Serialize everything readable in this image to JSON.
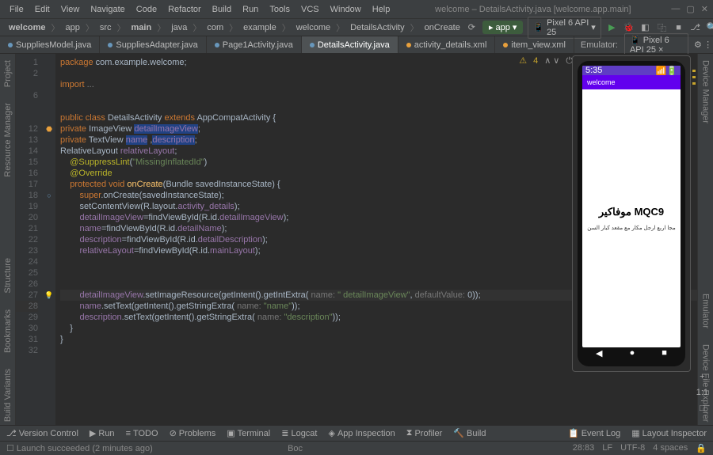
{
  "titlebar": {
    "menus": [
      "File",
      "Edit",
      "View",
      "Navigate",
      "Code",
      "Refactor",
      "Build",
      "Run",
      "Tools",
      "VCS",
      "Window",
      "Help"
    ],
    "title": "welcome – DetailsActivity.java [welcome.app.main]"
  },
  "breadcrumbs": [
    "welcome",
    "app",
    "src",
    "main",
    "java",
    "com",
    "example",
    "welcome",
    "DetailsActivity",
    "onCreate"
  ],
  "runconfig": {
    "label": "app",
    "device": "Pixel 6 API 25"
  },
  "tabs": [
    {
      "label": "SuppliesModel.java"
    },
    {
      "label": "SuppliesAdapter.java"
    },
    {
      "label": "Page1Activity.java"
    },
    {
      "label": "DetailsActivity.java",
      "active": true
    },
    {
      "label": "activity_details.xml"
    },
    {
      "label": "item_view.xml"
    }
  ],
  "emulator": {
    "label": "Emulator:",
    "device": "Pixel 6 API 25"
  },
  "leftrail": [
    "Project",
    "Resource Manager"
  ],
  "leftrail2": [
    "Bookmarks",
    "Structure"
  ],
  "leftrail3": [
    "Build Variants"
  ],
  "rightrail": [
    "Device Manager"
  ],
  "rightrail2": [
    "Emulator",
    "Device File Explorer"
  ],
  "warn": {
    "count": "4"
  },
  "lines": {
    "1": "1",
    "2": "2",
    "6": "6",
    "10": " ",
    "11": " ",
    "12": "12",
    "13": "13",
    "14": "14",
    "15": "15",
    "16": "16",
    "17": "17",
    "18": "18",
    "19": "19",
    "20": "20",
    "21": "21",
    "22": "22",
    "23": "23",
    "24": "24",
    "25": "25",
    "26": "26",
    "27": "27",
    "28": "28",
    "29": "29",
    "30": "30",
    "31": "31",
    "32": "32"
  },
  "code": {
    "l1_a": "package ",
    "l1_b": "com.example.welcome;",
    "l3_a": "import ",
    "l3_b": "...",
    "l5_a": "public class ",
    "l5_b": "DetailsActivity ",
    "l5_c": "extends ",
    "l5_d": "AppCompatActivity {",
    "l6_a": "private ",
    "l6_b": "ImageView ",
    "l6_c": "detailImageView",
    "l6_d": ";",
    "l7_a": "private ",
    "l7_b": "TextView ",
    "l7_c": "name",
    "l7_d": " ,",
    "l7_e": "description",
    "l7_f": ";",
    "l8_a": "RelativeLayout ",
    "l8_b": "relativeLayout",
    "l8_c": ";",
    "l9_a": "    @SuppressLint",
    "l9_b": "(",
    "l9_c": "\"MissingInflatedId\"",
    "l9_d": ")",
    "l10": "    @Override",
    "l11_a": "    protected void ",
    "l11_b": "onCreate",
    "l11_c": "(Bundle savedInstanceState) {",
    "l12_a": "        super",
    "l12_b": ".onCreate(savedInstanceState);",
    "l13_a": "        setContentView(R.layout.",
    "l13_b": "activity_details",
    "l13_c": ");",
    "l14_a": "        detailImageView",
    "l14_b": "=findViewById(R.id.",
    "l14_c": "detailImageView",
    "l14_d": ");",
    "l15_a": "        name",
    "l15_b": "=findViewById(R.id.",
    "l15_c": "detailName",
    "l15_d": ");",
    "l16_a": "        description",
    "l16_b": "=findViewById(R.id.",
    "l16_c": "detailDescription",
    "l16_d": ");",
    "l17_a": "        relativeLayout",
    "l17_b": "=findViewById(R.id.",
    "l17_c": "mainLayout",
    "l17_d": ");",
    "l21_a": "        detailImageView",
    "l21_b": ".setImageResource(getIntent().getIntExtra(",
    "l21_n": " name: ",
    "l21_c": "\" detailImageView\"",
    "l21_d": ", ",
    "l21_dv": "defaultValue: ",
    "l21_e": "0",
    "l21_f": "));",
    "l22_a": "        name",
    "l22_b": ".setText(getIntent().getStringExtra(",
    "l22_n": " name: ",
    "l22_c": "\"name\"",
    "l22_d": "));",
    "l23_a": "        description",
    "l23_b": ".setText(getIntent().getStringExtra(",
    "l23_n": " name: ",
    "l23_c": "\"description\"",
    "l23_d": "));",
    "l24": "    }",
    "l25": "}"
  },
  "phone": {
    "time": "5:35",
    "wifi": "▲",
    "appname": "welcome",
    "title": "موفاكير MQC9",
    "desc": "مجا اربع ارجل مكار مع مقعد كبار السن"
  },
  "bottombar": {
    "items": [
      "Version Control",
      "Run",
      "TODO",
      "Problems",
      "Terminal",
      "Logcat",
      "App Inspection",
      "Profiler",
      "Build"
    ],
    "right": [
      "Event Log",
      "Layout Inspector"
    ]
  },
  "status": {
    "msg": "Launch succeeded (2 minutes ago)",
    "mid": "Boc",
    "pos": "28:83",
    "le": "LF",
    "enc": "UTF-8",
    "indent": "4 spaces"
  },
  "zoom": {
    "plus": "+",
    "one": "1:1",
    "fit": "□"
  }
}
